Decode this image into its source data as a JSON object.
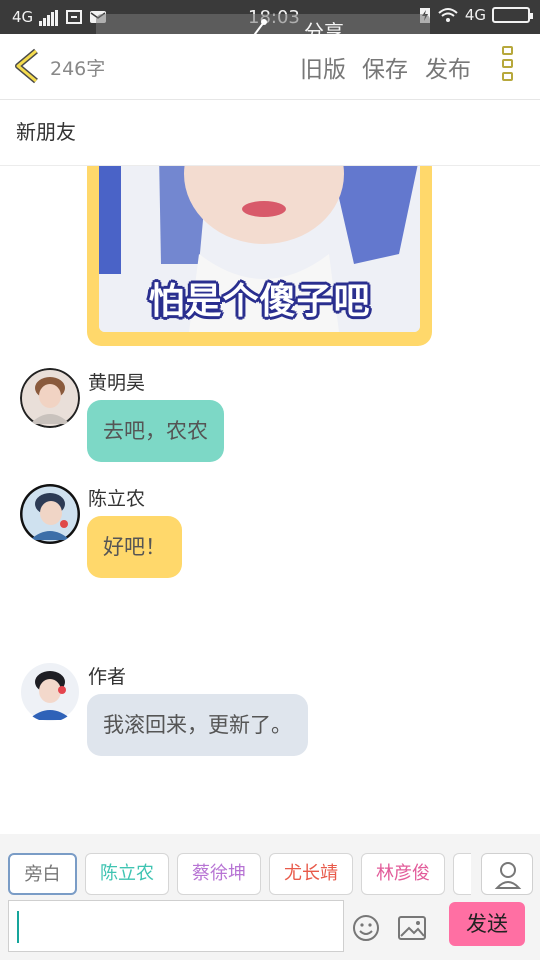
{
  "status_bar": {
    "network_left": "4G",
    "time": "18:03",
    "network_right": "4G"
  },
  "share": {
    "label": "分享"
  },
  "header": {
    "word_count": "246字",
    "old_version_label": "旧版",
    "save_label": "保存",
    "publish_label": "发布"
  },
  "chat": {
    "title": "新朋友"
  },
  "meme": {
    "caption": "怕是个傻子吧"
  },
  "messages": [
    {
      "sender": "黄明昊",
      "text": "去吧，农农",
      "bubble_color": "#7dd8c6",
      "avatar_color": "#8a5a3c"
    },
    {
      "sender": "陈立农",
      "text": "好吧！",
      "bubble_color": "#ffd86b",
      "avatar_color": "#3d6fa8"
    },
    {
      "sender": "作者",
      "text": "我滚回来，更新了。",
      "bubble_color": "#dfe5ed",
      "avatar_color": "#2f62b8"
    }
  ],
  "roles": [
    {
      "label": "旁白",
      "color": "#777777"
    },
    {
      "label": "陈立农",
      "color": "#3fc4b2"
    },
    {
      "label": "蔡徐坤",
      "color": "#b774d4"
    },
    {
      "label": "尤长靖",
      "color": "#e85a4a"
    },
    {
      "label": "林彦俊",
      "color": "#e25c9a"
    }
  ],
  "composer": {
    "send_label": "发送"
  },
  "icons": {
    "back": "chevron-left-icon",
    "menu": "kebab-menu-icon",
    "share": "share-icon",
    "add_role": "person-add-icon",
    "emoji": "emoji-icon",
    "image": "image-icon"
  }
}
